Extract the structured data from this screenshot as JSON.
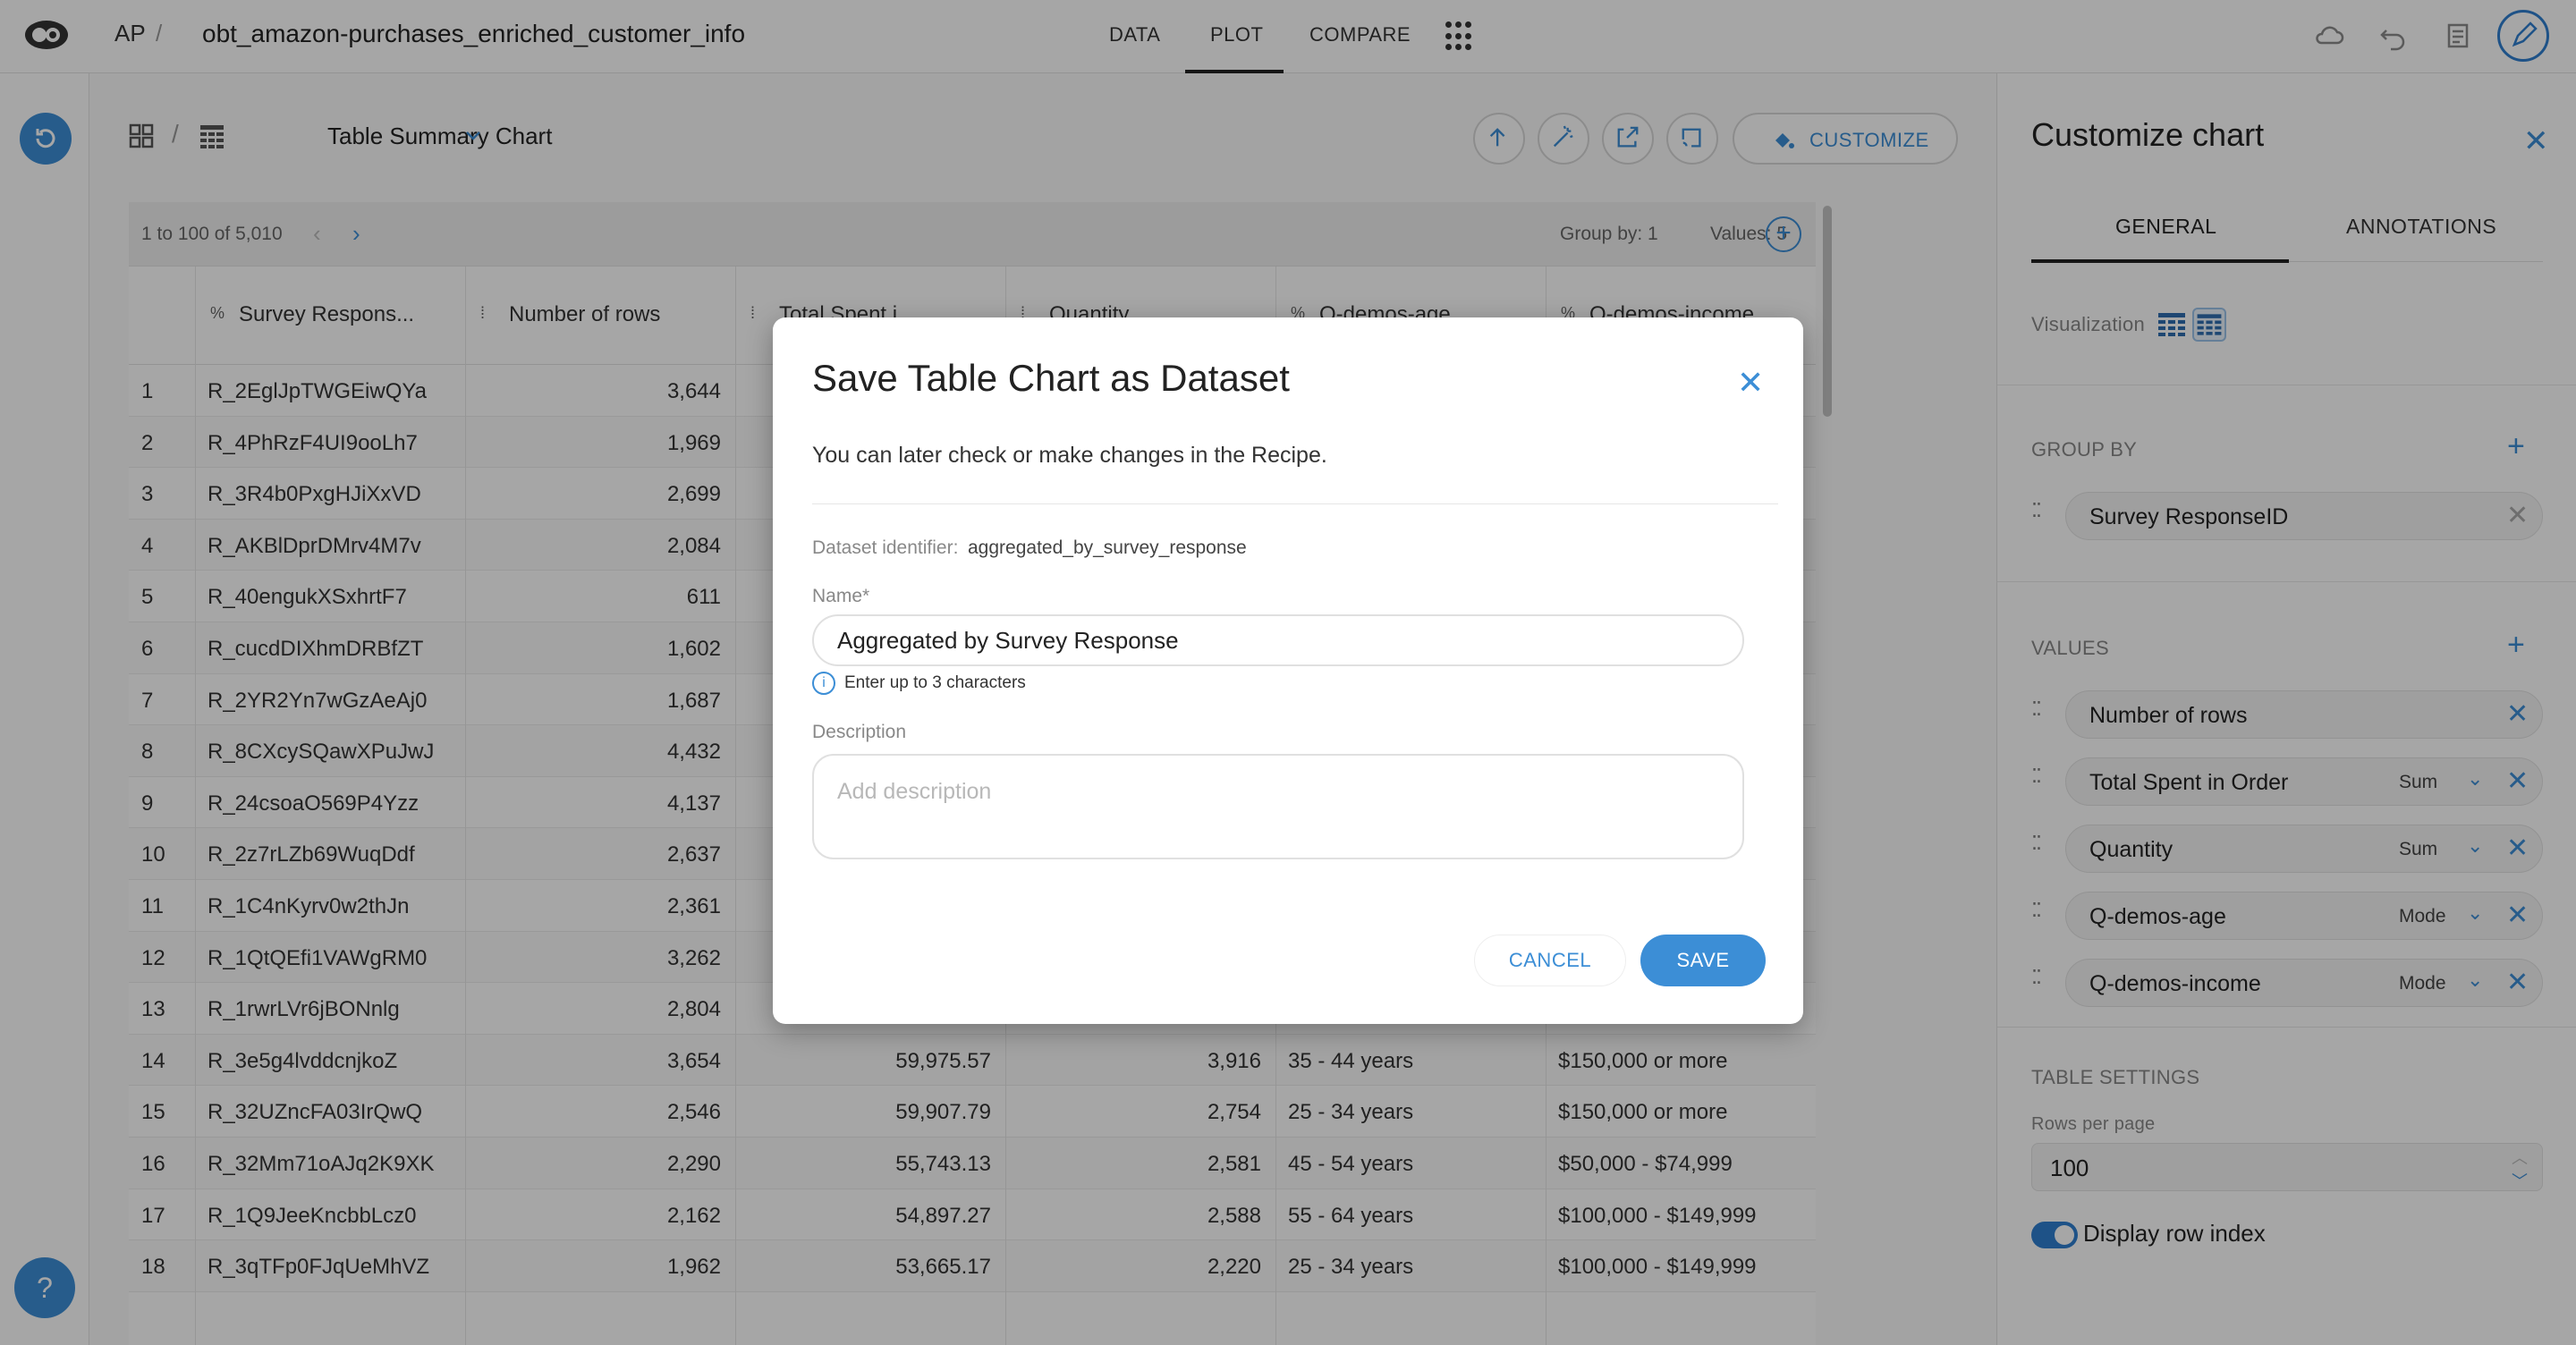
{
  "topbar": {
    "breadcrumb_root": "AP",
    "breadcrumb_sep": "/",
    "project_title": "obt_amazon-purchases_enriched_customer_info",
    "tabs": [
      {
        "label": "DATA"
      },
      {
        "label": "PLOT"
      },
      {
        "label": "COMPARE"
      }
    ],
    "active_tab": "PLOT"
  },
  "chart_header": {
    "sep": "/",
    "title": "Table Summary Chart",
    "customize_label": "CUSTOMIZE"
  },
  "table": {
    "range_text": "1 to 100 of 5,010",
    "group_by_text": "Group by: 1",
    "values_text": "Values: 5",
    "columns": [
      {
        "label": "Survey Respons..."
      },
      {
        "label": "Number of rows"
      },
      {
        "label": "Total Spent i..."
      },
      {
        "label": "Quantity"
      },
      {
        "label": "Q-demos-age"
      },
      {
        "label": "Q-demos-income"
      }
    ],
    "rows": [
      {
        "idx": "1",
        "id": "R_2EglJpTWGEiwQYa",
        "rows": "3,644",
        "spent": "",
        "qty": "",
        "age": "",
        "income": ""
      },
      {
        "idx": "2",
        "id": "R_4PhRzF4UI9ooLh7",
        "rows": "1,969",
        "spent": "",
        "qty": "",
        "age": "",
        "income": ""
      },
      {
        "idx": "3",
        "id": "R_3R4b0PxgHJiXxVD",
        "rows": "2,699",
        "spent": "",
        "qty": "",
        "age": "",
        "income": ""
      },
      {
        "idx": "4",
        "id": "R_AKBlDprDMrv4M7v",
        "rows": "2,084",
        "spent": "",
        "qty": "",
        "age": "",
        "income": ""
      },
      {
        "idx": "5",
        "id": "R_40engukXSxhrtF7",
        "rows": "611",
        "spent": "",
        "qty": "",
        "age": "",
        "income": ""
      },
      {
        "idx": "6",
        "id": "R_cucdDIXhmDRBfZT",
        "rows": "1,602",
        "spent": "",
        "qty": "",
        "age": "",
        "income": ""
      },
      {
        "idx": "7",
        "id": "R_2YR2Yn7wGzAeAj0",
        "rows": "1,687",
        "spent": "",
        "qty": "",
        "age": "",
        "income": ""
      },
      {
        "idx": "8",
        "id": "R_8CXcySQawXPuJwJ",
        "rows": "4,432",
        "spent": "",
        "qty": "",
        "age": "",
        "income": ""
      },
      {
        "idx": "9",
        "id": "R_24csoaO569P4Yzz",
        "rows": "4,137",
        "spent": "",
        "qty": "",
        "age": "",
        "income": ""
      },
      {
        "idx": "10",
        "id": "R_2z7rLZb69WuqDdf",
        "rows": "2,637",
        "spent": "",
        "qty": "",
        "age": "",
        "income": ""
      },
      {
        "idx": "11",
        "id": "R_1C4nKyrv0w2thJn",
        "rows": "2,361",
        "spent": "",
        "qty": "",
        "age": "",
        "income": ""
      },
      {
        "idx": "12",
        "id": "R_1QtQEfi1VAWgRM0",
        "rows": "3,262",
        "spent": "",
        "qty": "",
        "age": "",
        "income": ""
      },
      {
        "idx": "13",
        "id": "R_1rwrLVr6jBONnlg",
        "rows": "2,804",
        "spent": "",
        "qty": "",
        "age": "",
        "income": ""
      },
      {
        "idx": "14",
        "id": "R_3e5g4lvddcnjkoZ",
        "rows": "3,654",
        "spent": "59,975.57",
        "qty": "3,916",
        "age": "35 - 44 years",
        "income": "$150,000 or more"
      },
      {
        "idx": "15",
        "id": "R_32UZncFA03IrQwQ",
        "rows": "2,546",
        "spent": "59,907.79",
        "qty": "2,754",
        "age": "25 - 34 years",
        "income": "$150,000 or more"
      },
      {
        "idx": "16",
        "id": "R_32Mm71oAJq2K9XK",
        "rows": "2,290",
        "spent": "55,743.13",
        "qty": "2,581",
        "age": "45 - 54 years",
        "income": "$50,000 - $74,999"
      },
      {
        "idx": "17",
        "id": "R_1Q9JeeKncbbLcz0",
        "rows": "2,162",
        "spent": "54,897.27",
        "qty": "2,588",
        "age": "55 - 64 years",
        "income": "$100,000 - $149,999"
      },
      {
        "idx": "18",
        "id": "R_3qTFp0FJqUeMhVZ",
        "rows": "1,962",
        "spent": "53,665.17",
        "qty": "2,220",
        "age": "25 - 34 years",
        "income": "$100,000 - $149,999"
      }
    ]
  },
  "panel": {
    "title": "Customize chart",
    "tabs": [
      {
        "label": "GENERAL"
      },
      {
        "label": "ANNOTATIONS"
      }
    ],
    "visualization_label": "Visualization",
    "group_by_label": "GROUP BY",
    "group_by_items": [
      {
        "label": "Survey ResponseID"
      }
    ],
    "values_label": "VALUES",
    "values_items": [
      {
        "label": "Number of rows",
        "agg": ""
      },
      {
        "label": "Total Spent in Order",
        "agg": "Sum"
      },
      {
        "label": "Quantity",
        "agg": "Sum"
      },
      {
        "label": "Q-demos-age",
        "agg": "Mode"
      },
      {
        "label": "Q-demos-income",
        "agg": "Mode"
      }
    ],
    "table_settings_label": "TABLE SETTINGS",
    "rows_per_page_label": "Rows per page",
    "rows_per_page_value": "100",
    "display_row_index_label": "Display row index",
    "display_row_index_on": true
  },
  "modal": {
    "title": "Save Table Chart as Dataset",
    "subtitle": "You can later check or make changes in the Recipe.",
    "identifier_label": "Dataset identifier:",
    "identifier_value": "aggregated_by_survey_response",
    "name_label": "Name*",
    "name_value": "Aggregated by Survey Response",
    "hint": "Enter up to 3 characters",
    "description_label": "Description",
    "description_placeholder": "Add description",
    "cancel_label": "CANCEL",
    "save_label": "SAVE"
  },
  "help_label": "?",
  "colors": {
    "accent": "#3c8ed6",
    "overlay": "rgba(0,0,0,0.35)"
  }
}
